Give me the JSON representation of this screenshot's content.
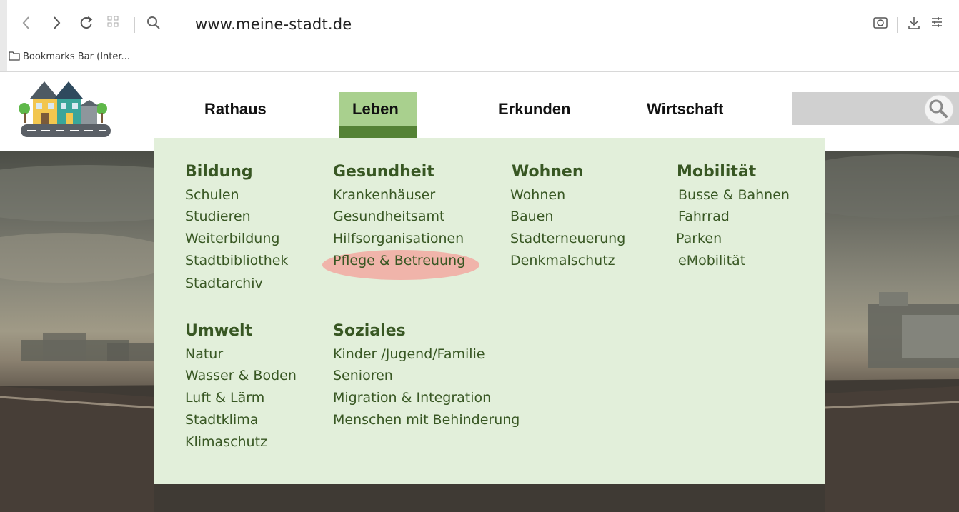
{
  "browser": {
    "url": "www.meine-stadt.de",
    "bookmarks_label": "Bookmarks Bar (Inter..."
  },
  "nav": {
    "items": [
      "Rathaus",
      "Leben",
      "Erkunden",
      "Wirtschaft"
    ],
    "active": "Leben"
  },
  "colors": {
    "menu_bg": "#e2efda",
    "menu_text": "#385723",
    "nav_active": "#a9d08e",
    "nav_active_bar": "#548235",
    "highlight": "#f2a9a1"
  },
  "menu": {
    "bildung": {
      "title": "Bildung",
      "items": [
        "Schulen",
        "Studieren",
        "Weiterbildung",
        "Stadtbibliothek",
        "Stadtarchiv"
      ]
    },
    "gesundheit": {
      "title": "Gesundheit",
      "items": [
        "Krankenhäuser",
        "Gesundheitsamt",
        "Hilfsorganisationen",
        "Pflege & Betreuung"
      ]
    },
    "wohnen": {
      "title": "Wohnen",
      "items": [
        "Wohnen",
        "Bauen",
        "Stadterneuerung",
        "Denkmalschutz"
      ]
    },
    "mobilitaet": {
      "title": "Mobilität",
      "items": [
        "Busse & Bahnen",
        "Fahrrad",
        "Parken",
        "eMobilität"
      ]
    },
    "umwelt": {
      "title": "Umwelt",
      "items": [
        "Natur",
        "Wasser & Boden",
        "Luft & Lärm",
        "Stadtklima",
        "Klimaschutz"
      ]
    },
    "soziales": {
      "title": "Soziales",
      "items": [
        "Kinder /Jugend/Familie",
        "Senioren",
        "Migration & Integration",
        "Menschen mit Behinderung"
      ]
    },
    "highlighted_item": "Pflege & Betreuung"
  }
}
